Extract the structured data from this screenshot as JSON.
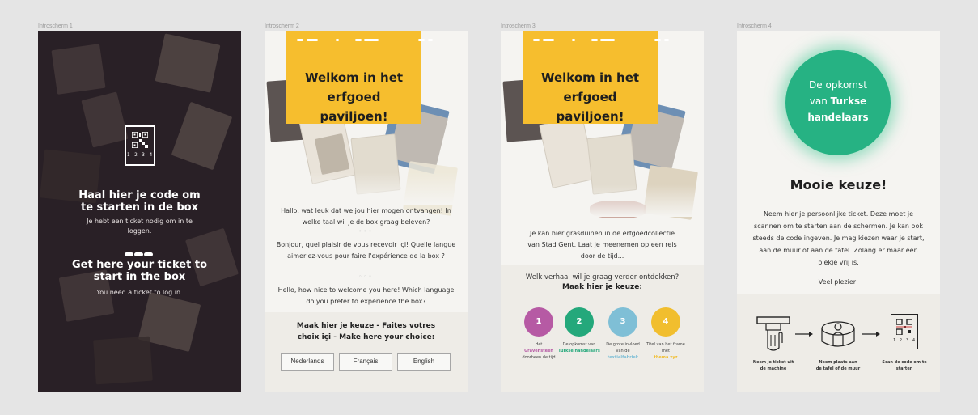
{
  "frames": [
    {
      "label": "Introscherm 1"
    },
    {
      "label": "Introscherm 2"
    },
    {
      "label": "Introscherm 3"
    },
    {
      "label": "Introscherm 4"
    }
  ],
  "screen1": {
    "qr_number": "1 2 3 4",
    "heading_nl": "Haal hier je code om te starten in de box",
    "body_nl": "Je hebt een ticket nodig om in te loggen.",
    "heading_en": "Get here your ticket to start in the box",
    "body_en": "You need a ticket to log in."
  },
  "screen2": {
    "banner_title": "Welkom in het erfgoed paviljoen!",
    "text_nl": "Hallo, wat leuk dat we jou hier mogen ontvangen! In welke taal wil je de box graag beleven?",
    "text_fr": "Bonjour, quel plaisir de vous recevoir içi! Quelle langue aimeriez-vous pour faire l'expérience de la box ?",
    "text_en": "Hello, how nice to welcome you here! Which language do you prefer to experience the box?",
    "choice_heading": "Maak hier je keuze - Faites votres choix içi - Make here your choice:",
    "languages": [
      "Nederlands",
      "Français",
      "English"
    ]
  },
  "screen3": {
    "banner_title": "Welkom in het erfgoed paviljoen!",
    "intro": "Je kan hier grasduinen in de erfgoedcollectie van Stad Gent. Laat je meenemen op een reis door de tijd...",
    "question": "Welk verhaal wil je graag verder ontdekken?",
    "question_bold": "Maak hier je keuze:",
    "stories": [
      {
        "number": "1",
        "line1": "Het",
        "highlight": "Gravensteen",
        "line3": "doorheen de tijd",
        "color": "#b65aa4"
      },
      {
        "number": "2",
        "line1": "De opkomst van",
        "highlight": "Turkse handelaars",
        "line3": "",
        "color": "#24a87b"
      },
      {
        "number": "3",
        "line1": "De grote invloed van de",
        "highlight": "textielfabriek",
        "line3": "",
        "color": "#7fbfd6"
      },
      {
        "number": "4",
        "line1": "Titel van het frame met",
        "highlight": "thema xyz",
        "line3": "",
        "color": "#f1be2e"
      }
    ]
  },
  "screen4": {
    "circle_line1": "De opkomst",
    "circle_line2": "van",
    "circle_bold2": "Turkse",
    "circle_line3": "handelaars",
    "heading": "Mooie keuze!",
    "body": "Neem hier je persoonlijke ticket. Deze moet je scannen om te starten aan de schermen. Je kan ook steeds de code ingeven. Je mag kiezen waar je start, aan de muur of aan de tafel. Zolang er maar een plekje vrij is.",
    "closing": "Veel plezier!",
    "qr_number": "1 2 3 4",
    "steps": [
      "Neem je ticket uit de machine",
      "Neem plaats aan de tafel of de muur",
      "Scan de code om te starten"
    ]
  },
  "colors": {
    "background": "#e5e5e5",
    "banner_yellow": "#f6be2e",
    "accent_green": "#26b283",
    "dark_screen": "#2c2228"
  }
}
